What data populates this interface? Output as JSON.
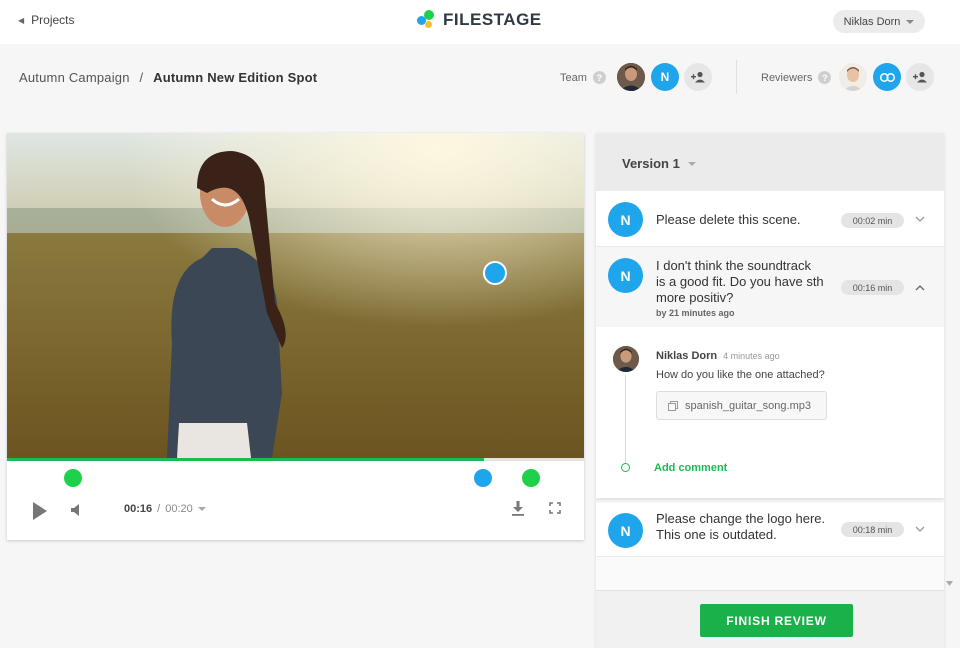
{
  "topbar": {
    "back_label": "Projects",
    "brand": "FILESTAGE",
    "user_name": "Niklas Dorn"
  },
  "breadcrumb": {
    "parent": "Autumn Campaign",
    "separator": "/",
    "current": "Autumn New Edition Spot"
  },
  "team": {
    "label": "Team",
    "help": "?",
    "member_initial": "N"
  },
  "reviewers": {
    "label": "Reviewers",
    "help": "?"
  },
  "player": {
    "current_time": "00:16",
    "separator": "/",
    "total_time": "00:20",
    "progress_fraction": 0.826,
    "marker_colors": [
      "#1ed14b",
      "#1fa5ec",
      "#1ed14b"
    ],
    "in_video_marker_color": "#1fa5ec"
  },
  "panel": {
    "version_label": "Version 1",
    "comments": [
      {
        "initial": "N",
        "text": "Please delete this scene.",
        "time": "00:02 min"
      },
      {
        "initial": "N",
        "text_lines": [
          "I don't think the soundtrack",
          "is a good fit. Do you have sth",
          "more positiv?"
        ],
        "meta_prefix": "by",
        "meta_age": "21 minutes ago",
        "time": "00:16 min",
        "reply": {
          "author": "Niklas Dorn",
          "age": "4 minutes ago",
          "text": "How do you like the one attached?",
          "attachment": "spanish_guitar_song.mp3"
        },
        "add_comment_label": "Add comment"
      },
      {
        "initial": "N",
        "text_lines": [
          "Please change the logo here.",
          "This one is outdated."
        ],
        "time": "00:18 min"
      }
    ],
    "finish_label": "FINISH REVIEW"
  },
  "colors": {
    "accent_green": "#1ab04a",
    "accent_blue": "#1fa5ec"
  }
}
